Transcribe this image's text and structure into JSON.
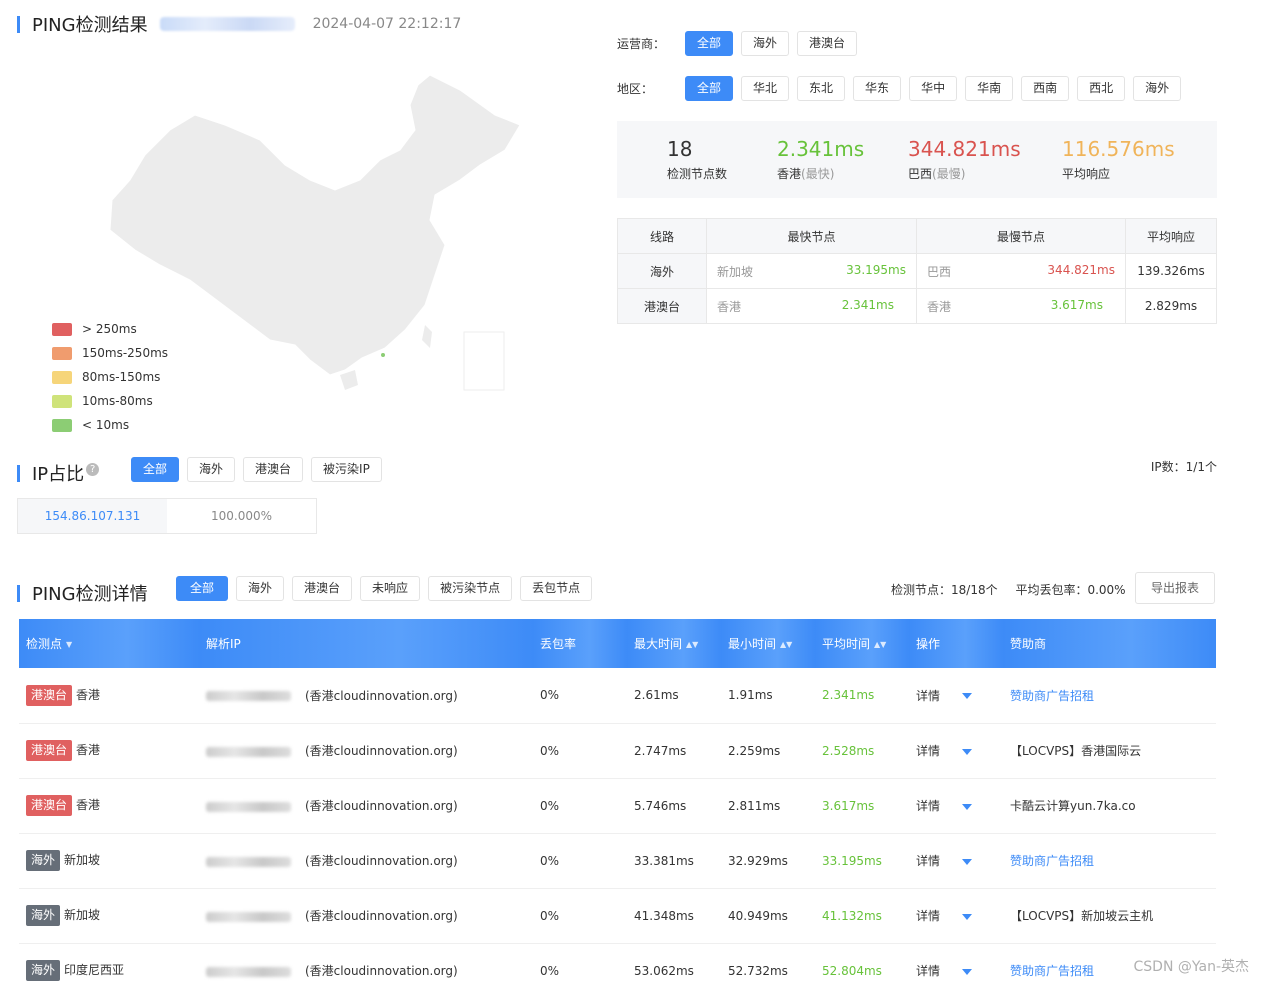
{
  "header": {
    "title": "PING检测结果",
    "datetime": "2024-04-07 22:12:17"
  },
  "filters": {
    "operator_label": "运营商：",
    "operators": [
      "全部",
      "海外",
      "港澳台"
    ],
    "region_label": "地区：",
    "regions": [
      "全部",
      "华北",
      "东北",
      "华东",
      "华中",
      "华南",
      "西南",
      "西北",
      "海外"
    ]
  },
  "summary": {
    "nodes": "18",
    "nodes_label": "检测节点数",
    "fastest": "2.341ms",
    "fastest_loc": "香港",
    "fastest_tag": "(最快)",
    "slowest": "344.821ms",
    "slowest_loc": "巴西",
    "slowest_tag": "(最慢)",
    "average": "116.576ms",
    "average_label": "平均响应"
  },
  "line_table": {
    "headers": [
      "线路",
      "最快节点",
      "最慢节点",
      "平均响应"
    ],
    "rows": [
      {
        "line": "海外",
        "fast_node": "新加坡",
        "fast_val": "33.195ms",
        "slow_node": "巴西",
        "slow_val": "344.821ms",
        "avg": "139.326ms"
      },
      {
        "line": "港澳台",
        "fast_node": "香港",
        "fast_val": "2.341ms",
        "slow_node": "香港",
        "slow_val": "3.617ms",
        "avg": "2.829ms"
      }
    ]
  },
  "legend": [
    {
      "label": "> 250ms",
      "color": "#e06060"
    },
    {
      "label": "150ms-250ms",
      "color": "#f09c6e"
    },
    {
      "label": "80ms-150ms",
      "color": "#f6d57a"
    },
    {
      "label": "10ms-80ms",
      "color": "#cfe37a"
    },
    {
      "label": "< 10ms",
      "color": "#8ccd74"
    }
  ],
  "ip_section": {
    "title": "IP占比",
    "tabs": [
      "全部",
      "海外",
      "港澳台",
      "被污染IP"
    ],
    "ip_count_label": "IP数：",
    "ip_count": "1/1个",
    "ip": "154.86.107.131",
    "percent": "100.000%"
  },
  "detail": {
    "title": "PING检测详情",
    "tabs": [
      "全部",
      "海外",
      "港澳台",
      "未响应",
      "被污染节点",
      "丢包节点"
    ],
    "nodes_label": "检测节点：",
    "nodes_value": "18/18个",
    "loss_label": "平均丢包率：",
    "loss_value": "0.00%",
    "export": "导出报表",
    "headers": [
      "检测点",
      "解析IP",
      "丢包率",
      "最大时间",
      "最小时间",
      "平均时间",
      "操作",
      "赞助商"
    ],
    "rows": [
      {
        "tag": "港澳台",
        "type": "hk",
        "loc": "香港",
        "ipnote": "(香港cloudinnovation.org)",
        "loss": "0%",
        "max": "2.61ms",
        "min": "1.91ms",
        "avg": "2.341ms",
        "op": "详情",
        "sponsor": "赞助商广告招租",
        "link": true
      },
      {
        "tag": "港澳台",
        "type": "hk",
        "loc": "香港",
        "ipnote": "(香港cloudinnovation.org)",
        "loss": "0%",
        "max": "2.747ms",
        "min": "2.259ms",
        "avg": "2.528ms",
        "op": "详情",
        "sponsor": "【LOCVPS】香港国际云",
        "link": false
      },
      {
        "tag": "港澳台",
        "type": "hk",
        "loc": "香港",
        "ipnote": "(香港cloudinnovation.org)",
        "loss": "0%",
        "max": "5.746ms",
        "min": "2.811ms",
        "avg": "3.617ms",
        "op": "详情",
        "sponsor": "卡酷云计算yun.7ka.co",
        "link": false
      },
      {
        "tag": "海外",
        "type": "os",
        "loc": "新加坡",
        "ipnote": "(香港cloudinnovation.org)",
        "loss": "0%",
        "max": "33.381ms",
        "min": "32.929ms",
        "avg": "33.195ms",
        "op": "详情",
        "sponsor": "赞助商广告招租",
        "link": true
      },
      {
        "tag": "海外",
        "type": "os",
        "loc": "新加坡",
        "ipnote": "(香港cloudinnovation.org)",
        "loss": "0%",
        "max": "41.348ms",
        "min": "40.949ms",
        "avg": "41.132ms",
        "op": "详情",
        "sponsor": "【LOCVPS】新加坡云主机",
        "link": false
      },
      {
        "tag": "海外",
        "type": "os",
        "loc": "印度尼西亚",
        "ipnote": "(香港cloudinnovation.org)",
        "loss": "0%",
        "max": "53.062ms",
        "min": "52.732ms",
        "avg": "52.804ms",
        "op": "详情",
        "sponsor": "赞助商广告招租",
        "link": true
      }
    ]
  },
  "watermark": "CSDN @Yan-英杰"
}
